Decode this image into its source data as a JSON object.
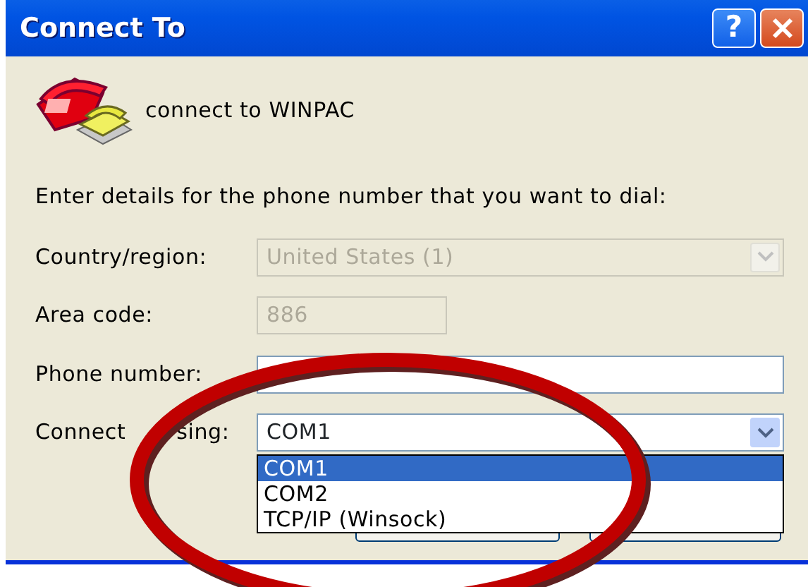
{
  "window": {
    "title": "Connect To",
    "title_buttons": [
      {
        "kind": "help",
        "label": "?"
      },
      {
        "kind": "close"
      }
    ]
  },
  "header": {
    "text": "connect to WINPAC"
  },
  "instruction": "Enter details for the phone number that you want to dial:",
  "fields": [
    {
      "kind": "combo",
      "label": "Country/region:",
      "value": "United States (1)",
      "disabled": true
    },
    {
      "kind": "short",
      "label": "Area code:",
      "value": "886",
      "disabled": true
    },
    {
      "kind": "text",
      "label": "Phone number:",
      "disabled": false
    },
    {
      "kind": "combo",
      "label_parts": [
        "Connect",
        "sing:"
      ],
      "value": "COM1",
      "disabled": false,
      "expanded": true,
      "options": [
        {
          "label": "COM1",
          "selected": true
        },
        {
          "label": "COM2",
          "selected": false
        },
        {
          "label": "TCP/IP (Winsock)",
          "selected": false
        }
      ]
    }
  ],
  "buttons": [
    {
      "kind": "blank"
    },
    {
      "kind": "blank"
    }
  ]
}
